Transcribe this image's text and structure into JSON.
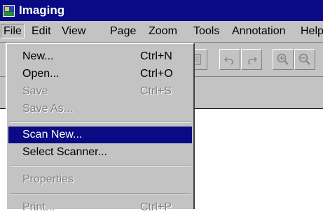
{
  "window": {
    "title": "Imaging"
  },
  "menubar": {
    "items": [
      {
        "label": "File"
      },
      {
        "label": "Edit"
      },
      {
        "label": "View"
      },
      {
        "label": "Page"
      },
      {
        "label": "Zoom"
      },
      {
        "label": "Tools"
      },
      {
        "label": "Annotation"
      },
      {
        "label": "Help"
      }
    ]
  },
  "file_menu": {
    "new": {
      "label": "New...",
      "shortcut": "Ctrl+N"
    },
    "open": {
      "label": "Open...",
      "shortcut": "Ctrl+O"
    },
    "save": {
      "label": "Save",
      "shortcut": "Ctrl+S"
    },
    "save_as": {
      "label": "Save As..."
    },
    "scan_new": {
      "label": "Scan New..."
    },
    "select_scanner": {
      "label": "Select Scanner..."
    },
    "properties": {
      "label": "Properties"
    },
    "print": {
      "label": "Print...",
      "shortcut": "Ctrl+P"
    }
  },
  "toolbar": {
    "icons": [
      "page-icon",
      "undo-icon",
      "redo-icon",
      "zoom-in-icon",
      "zoom-out-icon"
    ]
  },
  "colors": {
    "titlebar": "#0a0a84",
    "face": "#c3c3c3",
    "highlight": "#0a0a84",
    "disabled_text": "#808080"
  }
}
